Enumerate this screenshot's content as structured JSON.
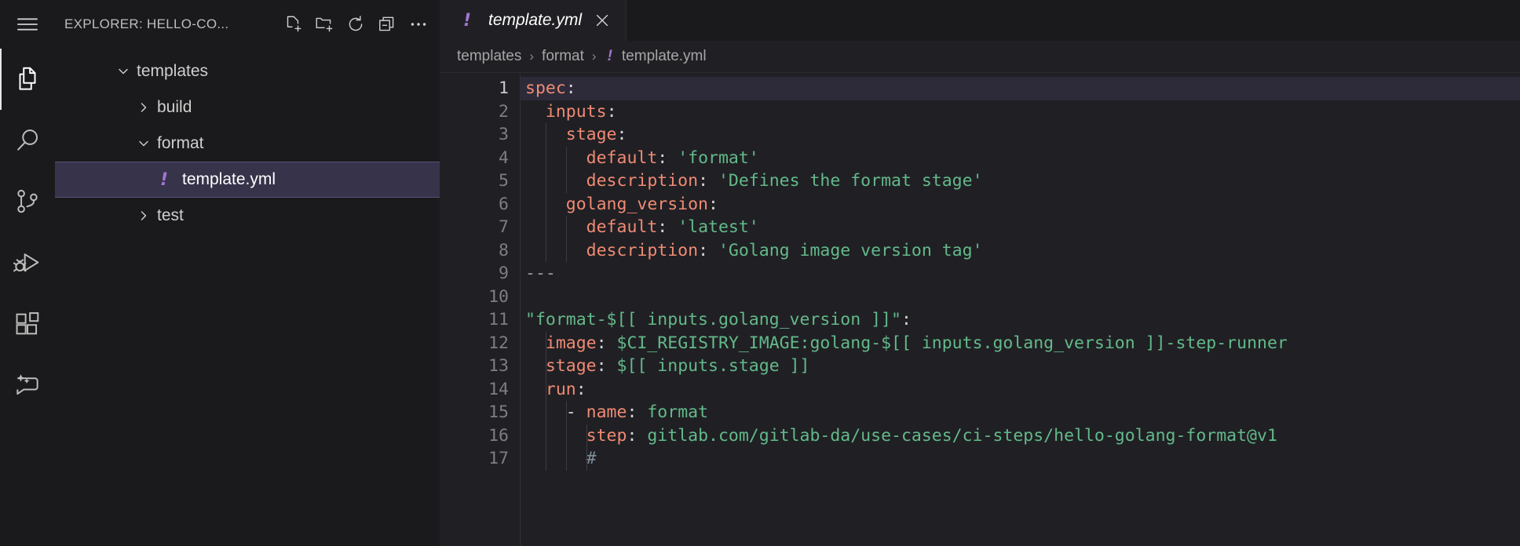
{
  "activitybar": {
    "items": [
      {
        "name": "hamburger-menu-icon",
        "label": "Menu"
      },
      {
        "name": "explorer-icon",
        "label": "Explorer",
        "active": true
      },
      {
        "name": "search-icon",
        "label": "Search"
      },
      {
        "name": "source-control-icon",
        "label": "Source Control"
      },
      {
        "name": "run-and-debug-icon",
        "label": "Run and Debug"
      },
      {
        "name": "extensions-icon",
        "label": "Extensions"
      },
      {
        "name": "chat-sparkle-icon",
        "label": "Chat"
      }
    ]
  },
  "sidebar": {
    "title": "EXPLORER: HELLO-CO...",
    "actions": [
      {
        "name": "new-file-icon",
        "label": "New File"
      },
      {
        "name": "new-folder-icon",
        "label": "New Folder"
      },
      {
        "name": "refresh-icon",
        "label": "Refresh Explorer"
      },
      {
        "name": "collapse-all-icon",
        "label": "Collapse Folders in Explorer"
      },
      {
        "name": "more-actions-icon",
        "label": "Views and More Actions"
      }
    ],
    "tree": [
      {
        "label": "templates",
        "type": "folder",
        "expanded": true,
        "depth": 0,
        "selected": false
      },
      {
        "label": "build",
        "type": "folder",
        "expanded": false,
        "depth": 1,
        "selected": false
      },
      {
        "label": "format",
        "type": "folder",
        "expanded": true,
        "depth": 1,
        "selected": false
      },
      {
        "label": "template.yml",
        "type": "file",
        "icon": "!",
        "depth": 2,
        "selected": true
      },
      {
        "label": "test",
        "type": "folder",
        "expanded": false,
        "depth": 1,
        "selected": false
      }
    ]
  },
  "editor": {
    "tab": {
      "label": "template.yml",
      "icon": "!",
      "preview": true,
      "close": "✕"
    },
    "breadcrumbs": [
      {
        "label": "templates"
      },
      {
        "label": "format"
      },
      {
        "label": "template.yml",
        "icon": "!"
      }
    ],
    "breadcrumb_separator": "›",
    "current_line": 1,
    "lines": [
      {
        "n": "1",
        "text": "spec:"
      },
      {
        "n": "2",
        "text": "  inputs:"
      },
      {
        "n": "3",
        "text": "    stage:"
      },
      {
        "n": "4",
        "text": "      default: 'format'"
      },
      {
        "n": "5",
        "text": "      description: 'Defines the format stage'"
      },
      {
        "n": "6",
        "text": "    golang_version:"
      },
      {
        "n": "7",
        "text": "      default: 'latest'"
      },
      {
        "n": "8",
        "text": "      description: 'Golang image version tag'"
      },
      {
        "n": "9",
        "text": "---"
      },
      {
        "n": "10",
        "text": ""
      },
      {
        "n": "11",
        "text": "\"format-$[[ inputs.golang_version ]]\":"
      },
      {
        "n": "12",
        "text": "  image: $CI_REGISTRY_IMAGE:golang-$[[ inputs.golang_version ]]-step-runner"
      },
      {
        "n": "13",
        "text": "  stage: $[[ inputs.stage ]]"
      },
      {
        "n": "14",
        "text": "  run:"
      },
      {
        "n": "15",
        "text": "    - name: format"
      },
      {
        "n": "16",
        "text": "      step: gitlab.com/gitlab-da/use-cases/ci-steps/hello-golang-format@v1"
      },
      {
        "n": "17",
        "text": "      #"
      }
    ]
  },
  "colors": {
    "key": "#f08a74",
    "string": "#63b98a",
    "punctuation": "#d5d5d5",
    "line_number": "#7d7d82",
    "selection_bg": "#37334a",
    "selection_border": "#5a5278",
    "yaml_icon": "#a476d4",
    "editor_bg": "#202024",
    "chrome_bg": "#1a1a1c",
    "current_line_bg": "#2d2b3a"
  }
}
